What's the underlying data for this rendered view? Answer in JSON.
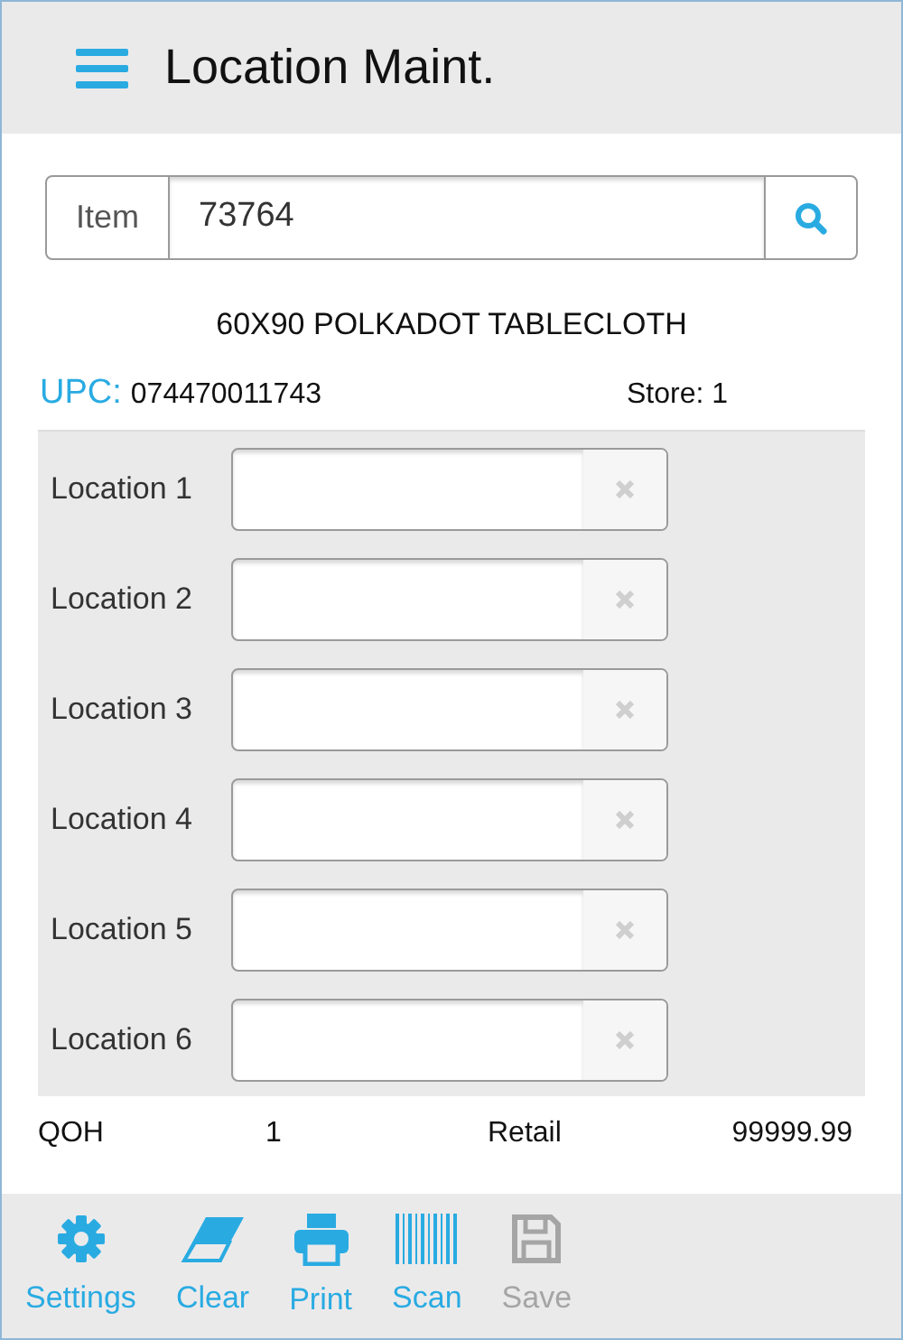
{
  "header": {
    "title": "Location Maint."
  },
  "item_search": {
    "label": "Item",
    "value": "73764"
  },
  "product": {
    "description": "60X90 POLKADOT TABLECLOTH",
    "upc_label": "UPC:",
    "upc": "074470011743",
    "store": "Store: 1"
  },
  "locations": [
    {
      "label": "Location 1"
    },
    {
      "label": "Location 2"
    },
    {
      "label": "Location 3"
    },
    {
      "label": "Location 4"
    },
    {
      "label": "Location 5"
    },
    {
      "label": "Location 6"
    }
  ],
  "summary": {
    "qoh_label": "QOH",
    "qoh": "1",
    "retail_label": "Retail",
    "retail": "99999.99"
  },
  "toolbar": [
    {
      "kind": "settings",
      "label": "Settings",
      "disabled": false
    },
    {
      "kind": "clear",
      "label": "Clear",
      "disabled": false
    },
    {
      "kind": "print",
      "label": "Print",
      "disabled": false
    },
    {
      "kind": "scan",
      "label": "Scan",
      "disabled": false
    },
    {
      "kind": "save",
      "label": "Save",
      "disabled": true
    }
  ]
}
